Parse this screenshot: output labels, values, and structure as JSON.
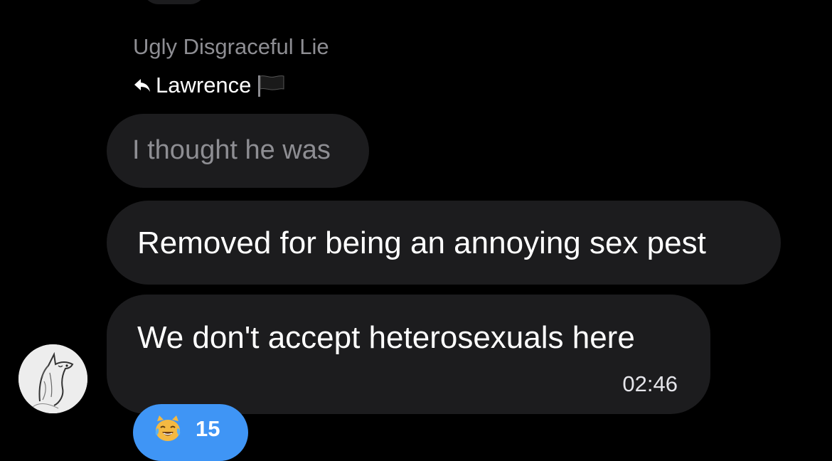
{
  "message": {
    "sender_name": "Ugly Disgraceful Lie",
    "reply_to": {
      "icon": "reply-arrow-icon",
      "name": "Lawrence",
      "flag_icon": "black-flag-icon"
    },
    "quoted_text": "I thought he was",
    "bubbles": [
      {
        "text": "Removed for being an annoying sex pest"
      },
      {
        "text": "We don't accept heterosexuals here",
        "time": "02:46"
      }
    ],
    "reaction": {
      "emoji_icon": "crying-laughing-cat-icon",
      "count": "15",
      "color": "#3f95f5"
    },
    "avatar_icon": "unicorn-sketch-avatar"
  },
  "colors": {
    "background": "#000000",
    "bubble": "#1c1c1e",
    "muted_text": "#8e8e93"
  }
}
